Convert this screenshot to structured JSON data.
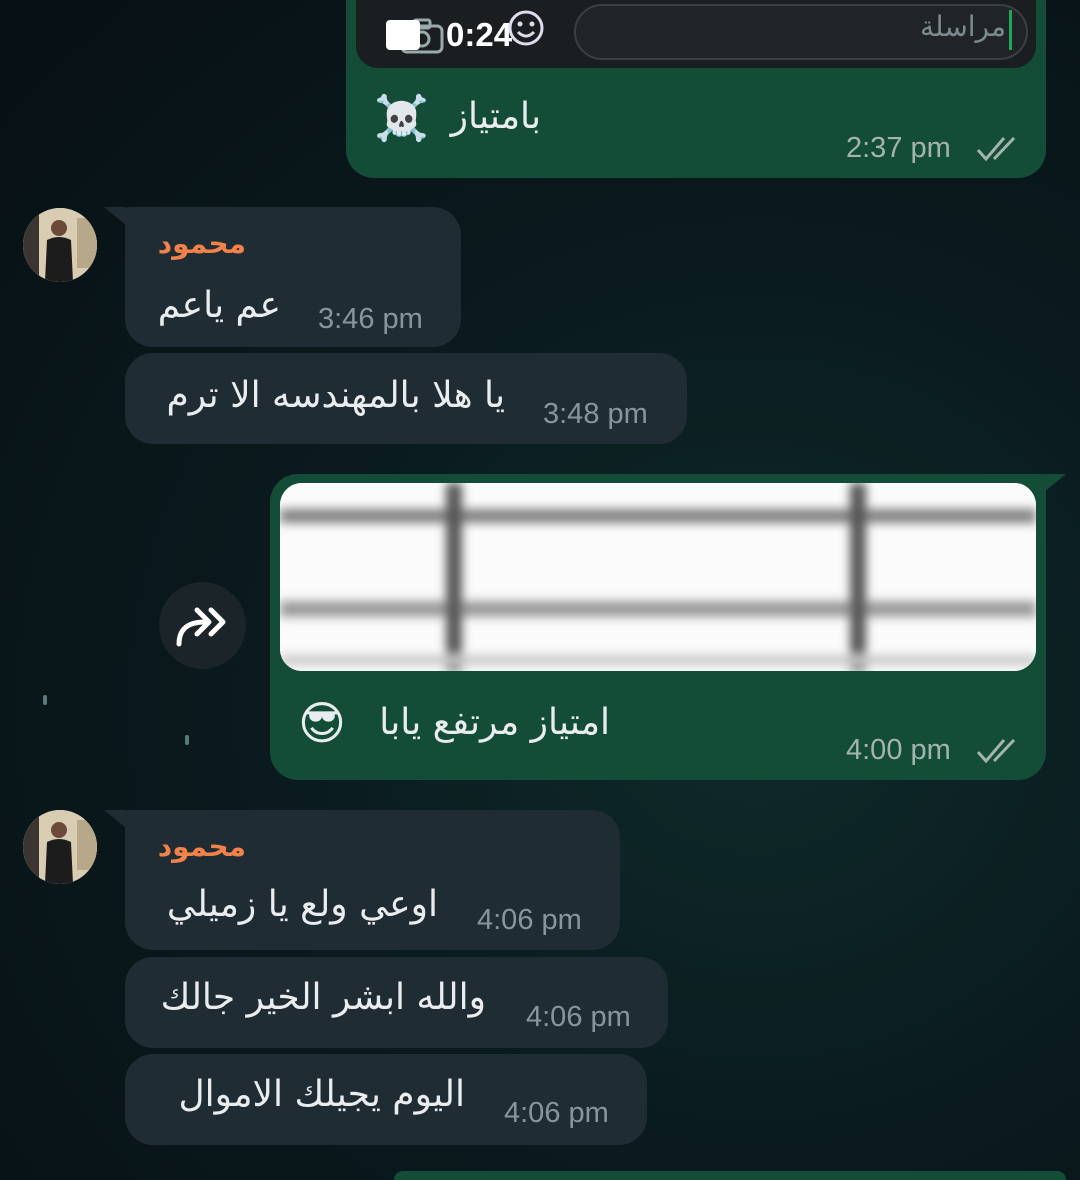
{
  "quoted_reply": {
    "duration": "0:24",
    "input_placeholder": "مراسلة"
  },
  "messages": [
    {
      "id": "m1",
      "direction": "out",
      "text": "بامتياز",
      "emoji": "☠️",
      "time": "2:37 pm",
      "status": "read"
    },
    {
      "id": "m2",
      "direction": "in",
      "sender": "محمود",
      "text": "عم ياعم",
      "time": "3:46 pm"
    },
    {
      "id": "m3",
      "direction": "in",
      "text": "يا هلا بالمهندسه الا ترم",
      "time": "3:48 pm"
    },
    {
      "id": "m4",
      "direction": "out",
      "media": "image",
      "text": "امتياز مرتفع يابا",
      "emoji": "😎",
      "time": "4:00 pm",
      "status": "read"
    },
    {
      "id": "m5",
      "direction": "in",
      "sender": "محمود",
      "text": "اوعي ولع يا زميلي",
      "time": "4:06 pm"
    },
    {
      "id": "m6",
      "direction": "in",
      "text": "والله ابشر الخير جالك",
      "time": "4:06 pm"
    },
    {
      "id": "m7",
      "direction": "in",
      "text": "اليوم يجيلك الاموال",
      "time": "4:06 pm"
    }
  ],
  "colors": {
    "outgoing_bubble": "#144d37",
    "incoming_bubble": "#202c33",
    "sender_name": "#f0824a",
    "timestamp": "#8696a0"
  },
  "icons": {
    "forward": "forward-icon",
    "read_receipt": "double-check-icon",
    "camera": "camera-icon",
    "emoji": "emoji-icon",
    "video": "video-icon"
  }
}
